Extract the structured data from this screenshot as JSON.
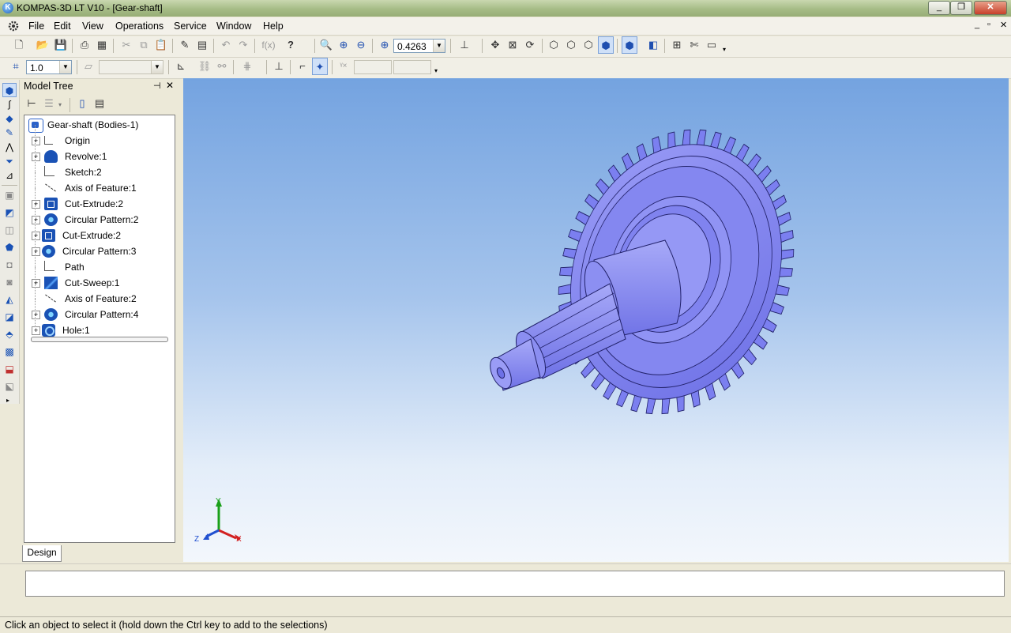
{
  "window": {
    "title": "KOMPAS-3D LT V10 - [Gear-shaft]",
    "app_icon_letter": "K",
    "minimize": "_",
    "restore": "❐",
    "close": "✕"
  },
  "menu": {
    "items": [
      "File",
      "Edit",
      "View",
      "Operations",
      "Service",
      "Window",
      "Help"
    ],
    "mdi_min": "_",
    "mdi_restore": "▫",
    "mdi_close": "✕"
  },
  "toolbar": {
    "zoom_value": "0.4263",
    "fx_label": "f(x)",
    "step_value": "1.0",
    "help_label": "?"
  },
  "model_tree": {
    "header": "Model Tree",
    "pin": "⊣",
    "close": "✕",
    "root": "Gear-shaft (Bodies-1)",
    "items": [
      {
        "label": "Origin",
        "icon": "origin-icon",
        "expandable": true
      },
      {
        "label": "Revolve:1",
        "icon": "revolve-icon",
        "expandable": true
      },
      {
        "label": "Sketch:2",
        "icon": "sketch-icon",
        "expandable": false
      },
      {
        "label": "Axis of Feature:1",
        "icon": "axis-icon",
        "expandable": false
      },
      {
        "label": "Cut-Extrude:2",
        "icon": "cut-extrude-icon",
        "expandable": true
      },
      {
        "label": "Circular Pattern:2",
        "icon": "circular-pattern-icon",
        "expandable": true
      },
      {
        "label": "Cut-Extrude:2",
        "icon": "cut-extrude-icon",
        "expandable": true
      },
      {
        "label": "Circular Pattern:3",
        "icon": "circular-pattern-icon",
        "expandable": true
      },
      {
        "label": "Path",
        "icon": "path-icon",
        "expandable": false
      },
      {
        "label": "Cut-Sweep:1",
        "icon": "cut-sweep-icon",
        "expandable": true
      },
      {
        "label": "Axis of Feature:2",
        "icon": "axis-icon",
        "expandable": false
      },
      {
        "label": "Circular Pattern:4",
        "icon": "circular-pattern-icon",
        "expandable": true
      },
      {
        "label": "Hole:1",
        "icon": "hole-icon",
        "expandable": true
      }
    ],
    "tab": "Design"
  },
  "viewport": {
    "axis_y": "Y",
    "axis_x": "X",
    "axis_z": "Z",
    "gear_color": "#7b7ff0"
  },
  "status": {
    "text": "Click an object to select it (hold down the Ctrl key to add to the selections)"
  },
  "colors": {
    "accent_blue": "#1a52b5"
  }
}
